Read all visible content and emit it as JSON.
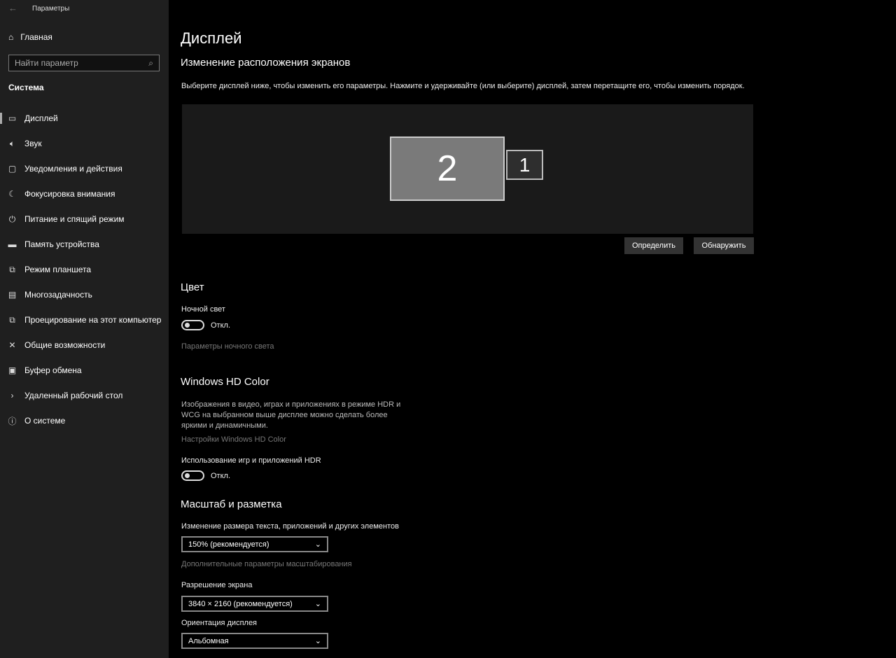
{
  "window": {
    "title": "Параметры"
  },
  "sidebar": {
    "home": "Главная",
    "search_placeholder": "Найти параметр",
    "section": "Система",
    "items": [
      {
        "label": "Дисплей",
        "icon": "monitor-icon"
      },
      {
        "label": "Звук",
        "icon": "speaker-icon"
      },
      {
        "label": "Уведомления и действия",
        "icon": "notification-icon"
      },
      {
        "label": "Фокусировка внимания",
        "icon": "moon-icon"
      },
      {
        "label": "Питание и спящий режим",
        "icon": "power-icon"
      },
      {
        "label": "Память устройства",
        "icon": "storage-icon"
      },
      {
        "label": "Режим планшета",
        "icon": "tablet-icon"
      },
      {
        "label": "Многозадачность",
        "icon": "multitask-icon"
      },
      {
        "label": "Проецирование на этот компьютер",
        "icon": "project-icon"
      },
      {
        "label": "Общие возможности",
        "icon": "shared-icon"
      },
      {
        "label": "Буфер обмена",
        "icon": "clipboard-icon"
      },
      {
        "label": "Удаленный рабочий стол",
        "icon": "remote-icon"
      },
      {
        "label": "О системе",
        "icon": "info-icon"
      }
    ]
  },
  "main": {
    "title": "Дисплей",
    "arrange": {
      "heading": "Изменение расположения экранов",
      "desc": "Выберите дисплей ниже, чтобы изменить его параметры. Нажмите и удерживайте (или выберите) дисплей, затем перетащите его, чтобы изменить порядок.",
      "monitor_2": "2",
      "monitor_1": "1",
      "identify": "Определить",
      "detect": "Обнаружить"
    },
    "color": {
      "heading": "Цвет",
      "night_label": "Ночной свет",
      "night_state": "Откл.",
      "night_link": "Параметры ночного света"
    },
    "hd": {
      "heading": "Windows HD Color",
      "desc1": "Изображения в видео, играх и приложениях в режиме HDR и",
      "desc2": "WCG на выбранном выше дисплее можно сделать более",
      "desc3": "яркими и динамичными.",
      "link": "Настройки Windows HD Color",
      "hdr_label": "Использование игр и приложений HDR",
      "hdr_state": "Откл."
    },
    "scale": {
      "heading": "Масштаб и разметка",
      "size_label": "Изменение размера текста, приложений и других элементов",
      "size_value": "150% (рекомендуется)",
      "adv_link": "Дополнительные параметры масштабирования",
      "res_label": "Разрешение экрана",
      "res_value": "3840 × 2160 (рекомендуется)",
      "orient_label": "Ориентация дисплея",
      "orient_value": "Альбомная"
    }
  }
}
